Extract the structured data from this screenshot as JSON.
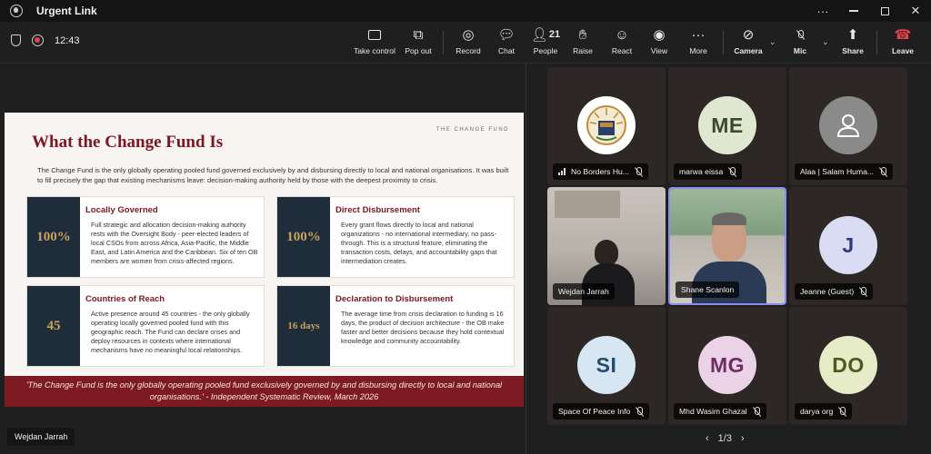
{
  "window": {
    "title": "Urgent Link",
    "more": "···"
  },
  "toolbar": {
    "timer": "12:43",
    "take_control": "Take control",
    "pop_out": "Pop out",
    "record": "Record",
    "chat": "Chat",
    "people": "People",
    "people_count": "21",
    "raise": "Raise",
    "react": "React",
    "view": "View",
    "more": "More",
    "camera": "Camera",
    "mic": "Mic",
    "share": "Share",
    "leave": "Leave"
  },
  "slide": {
    "brand": "THE CHANGE FUND",
    "title": "What the Change Fund Is",
    "intro": "The Change Fund is the only globally operating pooled fund governed exclusively by and disbursing directly to local and national organisations. It was built to fill precisely the gap that existing mechanisms leave: decision-making authority held by those with the deepest proximity to crisis.",
    "cards": [
      {
        "num": "100%",
        "title": "Locally Governed",
        "body": "Full strategic and allocation decision-making authority rests with the Oversight Body - peer-elected leaders of local CSOs from across Africa, Asia-Pacific, the Middle East, and Latin America and the Caribbean. Six of ten OB members are women from crisis-affected regions."
      },
      {
        "num": "100%",
        "title": "Direct Disbursement",
        "body": "Every grant flows directly to local and national organizations - no international intermediary, no pass-through. This is a structural feature, eliminating the transaction costs, delays, and accountability gaps that intermediation creates."
      },
      {
        "num": "45",
        "title": "Countries of Reach",
        "body": "Active presence around 45 countries - the only globally operating locally governed pooled fund with this geographic reach. The Fund can declare crises and deploy resources in contexts where international mechanisms have no meaningful local relationships."
      },
      {
        "num": "16 days",
        "title": "Declaration to Disbursement",
        "body": "The average time from crisis declaration to funding is 16 days, the product of decision architecture - the OB make faster and better decisions because they hold contextual knowledge and community accountability."
      }
    ],
    "quote": "'The Change Fund is the only globally operating pooled fund exclusively governed by and disbursing directly to local and national organisations.' - Independent Systematic Review, March 2026"
  },
  "presenter": "Wejdan Jarrah",
  "participants": [
    {
      "name": "No Borders Hu...",
      "initials": "",
      "type": "logo"
    },
    {
      "name": "marwa eissa",
      "initials": "ME",
      "type": "avatar"
    },
    {
      "name": "Alaa | Salam Huma...",
      "initials": "",
      "type": "person-icon"
    },
    {
      "name": "Wejdan Jarrah",
      "initials": "",
      "type": "video"
    },
    {
      "name": "Shane Scanlon",
      "initials": "",
      "type": "video"
    },
    {
      "name": "Jeanne (Guest)",
      "initials": "J",
      "type": "avatar"
    },
    {
      "name": "Space Of Peace Info",
      "initials": "SI",
      "type": "avatar"
    },
    {
      "name": "Mhd Wasim Ghazal",
      "initials": "MG",
      "type": "avatar"
    },
    {
      "name": "darya org",
      "initials": "DO",
      "type": "avatar"
    }
  ],
  "pager": {
    "label": "1/3"
  },
  "colors": {
    "accent_red": "#7a1722",
    "navy": "#1f2c3a",
    "gold": "#c9a35b",
    "leave": "#e0414a",
    "selected_border": "#8a8df0"
  }
}
